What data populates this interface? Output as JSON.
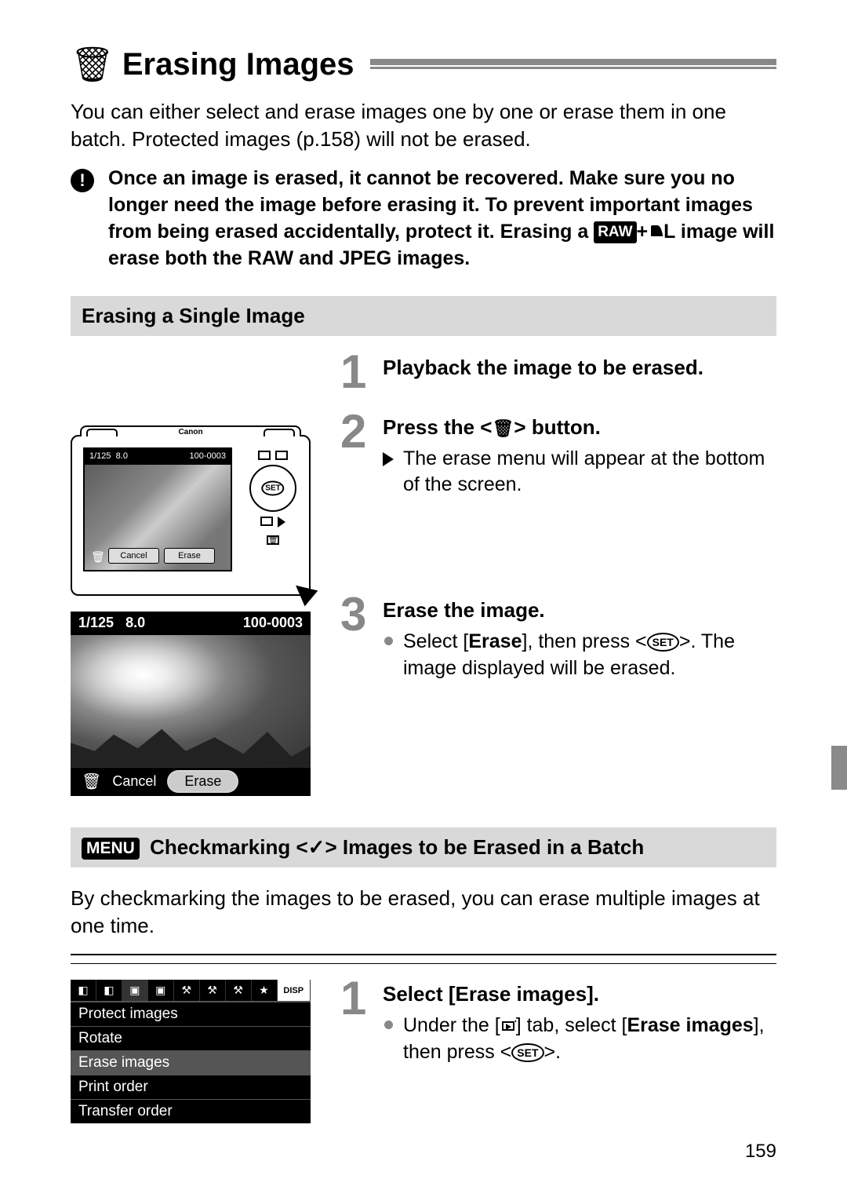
{
  "page_number": "159",
  "title": "Erasing Images",
  "intro": "You can either select and erase images one by one or erase them in one batch. Protected images (p.158) will not be erased.",
  "warning": {
    "line1": "Once an image is erased, it cannot be recovered. Make sure you no longer need the image before erasing it. To prevent important images from being erased accidentally, protect it. Erasing a",
    "raw_label": "RAW",
    "line2": " image will erase both the RAW and JPEG images.",
    "plus": "+",
    "quality_letter": "L"
  },
  "section1": {
    "heading": "Erasing a Single Image",
    "steps": [
      {
        "num": "1",
        "title": "Playback the image to be erased."
      },
      {
        "num": "2",
        "title_pre": "Press the <",
        "title_post": "> button.",
        "bullet": "The erase menu will appear at the bottom of the screen."
      },
      {
        "num": "3",
        "title": "Erase the image.",
        "bullet_pre": "Select [",
        "erase_word": "Erase",
        "bullet_mid": "], then press <",
        "bullet_post": ">. The image displayed will be erased.",
        "set_label": "SET"
      }
    ]
  },
  "camera_lcd": {
    "shutter": "1/125",
    "aperture": "8.0",
    "file_no": "100-0003",
    "cancel": "Cancel",
    "erase": "Erase"
  },
  "erase_lcd": {
    "shutter": "1/125",
    "aperture": "8.0",
    "file_no": "100-0003",
    "cancel": "Cancel",
    "erase": "Erase"
  },
  "section2": {
    "menu_badge": "MENU",
    "heading_pre": " Checkmarking <",
    "check": "✓",
    "heading_post": "> Images to be Erased in a Batch",
    "intro": "By checkmarking the images to be erased, you can erase multiple images at one time.",
    "step": {
      "num": "1",
      "title": "Select [Erase images].",
      "bullet_pre": "Under the [",
      "bullet_mid": "] tab, select [",
      "erase_images": "Erase images",
      "bullet_mid2": "], then press <",
      "bullet_post": ">.",
      "set_label": "SET"
    }
  },
  "menu_shot": {
    "disp": "DISP",
    "items": [
      "Protect images",
      "Rotate",
      "Erase images",
      "Print order",
      "Transfer order"
    ]
  }
}
